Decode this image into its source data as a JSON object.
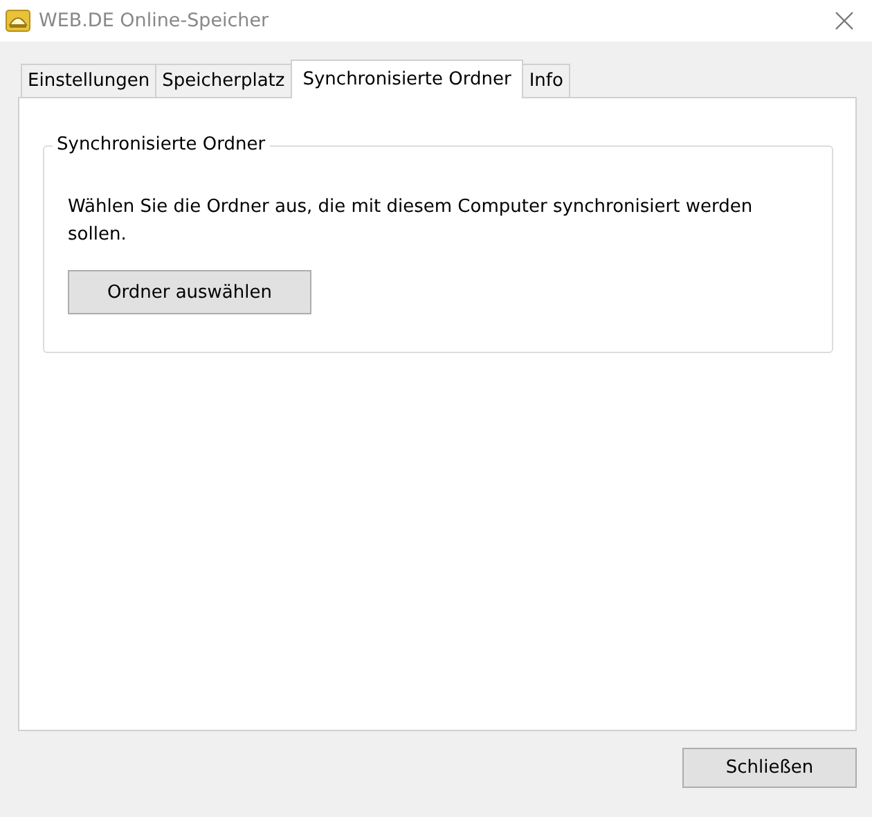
{
  "window": {
    "title": "WEB.DE Online-Speicher"
  },
  "tabs": [
    {
      "label": "Einstellungen",
      "selected": false
    },
    {
      "label": "Speicherplatz",
      "selected": false
    },
    {
      "label": "Synchronisierte Ordner",
      "selected": true
    },
    {
      "label": "Info",
      "selected": false
    }
  ],
  "group": {
    "title": "Synchronisierte Ordner",
    "text": "Wählen Sie die Ordner aus, die mit diesem Computer synchronisiert werden sollen.",
    "button": "Ordner auswählen"
  },
  "buttons": [
    "Schließen"
  ]
}
